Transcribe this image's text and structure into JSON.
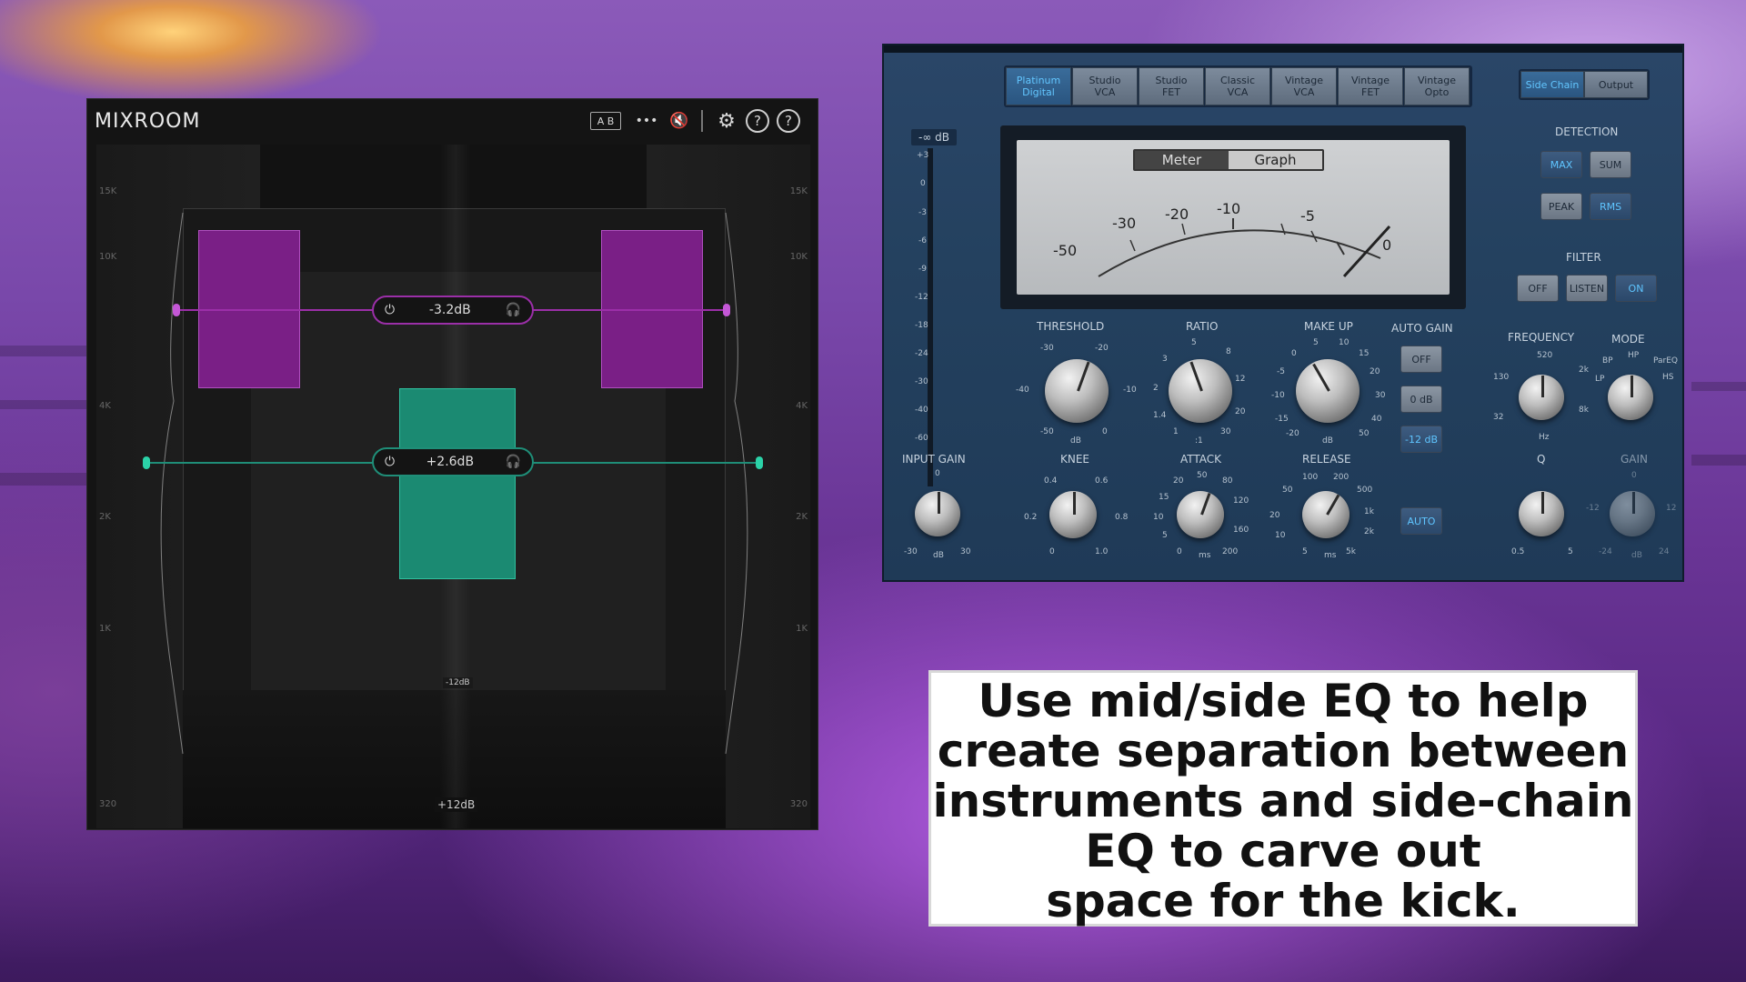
{
  "mixroom": {
    "title": "MIXROOM",
    "ab_label": "A B",
    "more_label": "•••",
    "mute_label": "🔇",
    "settings_label": "⚙",
    "help1_label": "?",
    "help2_label": "?",
    "freq_left": [
      "15K",
      "10K",
      "4K",
      "2K",
      "1K",
      "320"
    ],
    "freq_right": [
      "15K",
      "10K",
      "4K",
      "2K",
      "1K",
      "320"
    ],
    "side_band": {
      "power_icon": "⏻",
      "value": "-3.2dB",
      "listen_icon": "🎧",
      "color": "#9b2fa8"
    },
    "mid_band": {
      "power_icon": "⏻",
      "value": "+2.6dB",
      "listen_icon": "🎧",
      "color": "#1f8e78"
    },
    "floor_label": "-12dB",
    "bottom_label": "+12dB",
    "accent_purple": "#7a1f86",
    "accent_teal": "#1b8a72"
  },
  "compressor": {
    "models": [
      {
        "label": "Platinum\nDigital",
        "active": true
      },
      {
        "label": "Studio\nVCA",
        "active": false
      },
      {
        "label": "Studio\nFET",
        "active": false
      },
      {
        "label": "Classic\nVCA",
        "active": false
      },
      {
        "label": "Vintage\nVCA",
        "active": false
      },
      {
        "label": "Vintage\nFET",
        "active": false
      },
      {
        "label": "Vintage\nOpto",
        "active": false
      }
    ],
    "side_chain_tab": "Side Chain",
    "output_tab": "Output",
    "gr_header": "-∞ dB",
    "gr_scale": [
      "+3",
      "0",
      "-3",
      "-6",
      "-9",
      "-12",
      "-18",
      "-24",
      "-30",
      "-40",
      "-60"
    ],
    "meter_tab": "Meter",
    "graph_tab": "Graph",
    "meter_scale": [
      "-50",
      "-30",
      "-20",
      "-10",
      "-5",
      "0"
    ],
    "threshold": {
      "label": "THRESHOLD",
      "scale": [
        "-30",
        "-20",
        "-40",
        "-10",
        "-50",
        "0"
      ],
      "unit": "dB"
    },
    "ratio": {
      "label": "RATIO",
      "scale": [
        "5",
        "3",
        "8",
        "2",
        "12",
        "1.4",
        "20",
        "1",
        "30"
      ],
      "unit": ":1"
    },
    "makeup": {
      "label": "MAKE UP",
      "scale": [
        "5",
        "10",
        "0",
        "15",
        "-5",
        "20",
        "-10",
        "30",
        "-15",
        "40",
        "-20",
        "50"
      ],
      "unit": "dB"
    },
    "auto_gain": {
      "label": "AUTO GAIN",
      "off": "OFF",
      "zero": "0 dB",
      "minus12": "-12 dB"
    },
    "input_gain": {
      "label": "INPUT GAIN",
      "scale": [
        "0",
        "-30",
        "30"
      ],
      "unit": "dB"
    },
    "knee": {
      "label": "KNEE",
      "scale": [
        "0.4",
        "0.6",
        "0.2",
        "0.8",
        "0",
        "1.0"
      ]
    },
    "attack": {
      "label": "ATTACK",
      "scale": [
        "50",
        "20",
        "80",
        "15",
        "120",
        "10",
        "160",
        "5",
        "0",
        "200"
      ],
      "unit": "ms"
    },
    "release": {
      "label": "RELEASE",
      "scale": [
        "100",
        "200",
        "50",
        "500",
        "20",
        "1k",
        "10",
        "2k",
        "5",
        "5k"
      ],
      "unit": "ms"
    },
    "auto_release": "AUTO",
    "detection": {
      "label": "DETECTION",
      "max": "MAX",
      "sum": "SUM",
      "peak": "PEAK",
      "rms": "RMS"
    },
    "filter": {
      "label": "FILTER",
      "off": "OFF",
      "listen": "LISTEN",
      "on": "ON"
    },
    "frequency": {
      "label": "FREQUENCY",
      "scale": [
        "520",
        "130",
        "2k",
        "32",
        "8k"
      ],
      "unit": "Hz"
    },
    "mode": {
      "label": "MODE",
      "scale": [
        "HP",
        "BP",
        "ParEQ",
        "LP",
        "HS"
      ]
    },
    "q": {
      "label": "Q",
      "scale": [
        "0.5",
        "5"
      ]
    },
    "gain": {
      "label": "GAIN",
      "scale": [
        "0",
        "-12",
        "12",
        "-24",
        "24"
      ],
      "unit": "dB"
    },
    "accent": "#5fc5ff"
  },
  "caption": {
    "line1": "Use mid/side EQ to help",
    "line2": "create separation between",
    "line3": "instruments and side-chain",
    "line4": "EQ to carve out",
    "line5": "space for the kick."
  }
}
